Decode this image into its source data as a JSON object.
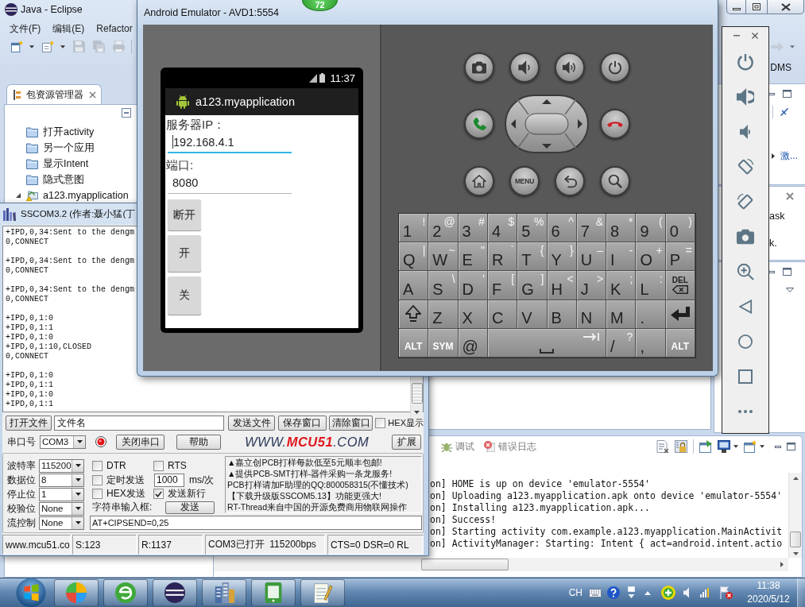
{
  "eclipse": {
    "title": "Java - Eclipse",
    "menu": [
      "文件(F)",
      "编辑(E)",
      "Refactor"
    ],
    "perspective": "DMS",
    "explorer": {
      "tab": "包资源管理器",
      "items": [
        {
          "kind": "folder",
          "label": "打开activity"
        },
        {
          "kind": "folder",
          "label": "另一个应用"
        },
        {
          "kind": "folder",
          "label": "显示Intent"
        },
        {
          "kind": "folder",
          "label": "隐式意图"
        },
        {
          "kind": "project",
          "label": "a123.myapplication",
          "expanded": true
        }
      ]
    },
    "side_link": "激...",
    "side_texts": [
      "ask",
      "k."
    ],
    "console": {
      "tabs": [
        {
          "kind": "debug",
          "label": "调试"
        },
        {
          "kind": "error-log",
          "label": "错误日志"
        }
      ],
      "lines": [
        "on] HOME is up on device 'emulator-5554'",
        "on] Uploading a123.myapplication.apk onto device 'emulator-5554'",
        "on] Installing a123.myapplication.apk...",
        "on] Success!",
        "on] Starting activity com.example.a123.myapplication.MainActivit",
        "on] ActivityManager: Starting: Intent { act=android.intent.actio"
      ]
    }
  },
  "badge": "72",
  "emulator": {
    "title": "Android Emulator - AVD1:5554",
    "phone": {
      "time": "11:37",
      "app_title": "a123.myapplication",
      "fields": [
        {
          "label": "服务器IP：",
          "value": "192.168.4.1",
          "focused": true
        },
        {
          "label": "端口:",
          "value": "8080",
          "focused": false
        }
      ],
      "buttons": [
        "断开",
        "开",
        "关"
      ]
    },
    "menu_key": "MENU",
    "keyboard": [
      [
        {
          "kind": "char",
          "main": "1",
          "alt": "!"
        },
        {
          "kind": "char",
          "main": "2",
          "alt": "@"
        },
        {
          "kind": "char",
          "main": "3",
          "alt": "#"
        },
        {
          "kind": "char",
          "main": "4",
          "alt": "$"
        },
        {
          "kind": "char",
          "main": "5",
          "alt": "%"
        },
        {
          "kind": "char",
          "main": "6",
          "alt": "^"
        },
        {
          "kind": "char",
          "main": "7",
          "alt": "&"
        },
        {
          "kind": "char",
          "main": "8",
          "alt": "*"
        },
        {
          "kind": "char",
          "main": "9",
          "alt": "("
        },
        {
          "kind": "char",
          "main": "0",
          "alt": ")"
        }
      ],
      [
        {
          "kind": "char",
          "main": "Q",
          "alt": "|"
        },
        {
          "kind": "char",
          "main": "W",
          "alt": "~"
        },
        {
          "kind": "char",
          "main": "E",
          "alt": "\""
        },
        {
          "kind": "char",
          "main": "R",
          "alt": "`"
        },
        {
          "kind": "char",
          "main": "T",
          "alt": "{"
        },
        {
          "kind": "char",
          "main": "Y",
          "alt": "}"
        },
        {
          "kind": "char",
          "main": "U",
          "alt": "–"
        },
        {
          "kind": "char",
          "main": "I",
          "alt": "-"
        },
        {
          "kind": "char",
          "main": "O",
          "alt": "+"
        },
        {
          "kind": "char",
          "main": "P",
          "alt": "="
        }
      ],
      [
        {
          "kind": "char",
          "main": "A"
        },
        {
          "kind": "char",
          "main": "S",
          "alt": "\\"
        },
        {
          "kind": "char",
          "main": "D",
          "alt": "'"
        },
        {
          "kind": "char",
          "main": "F",
          "alt": "["
        },
        {
          "kind": "char",
          "main": "G",
          "alt": "]"
        },
        {
          "kind": "char",
          "main": "H",
          "alt": "<"
        },
        {
          "kind": "char",
          "main": "J",
          "alt": ">"
        },
        {
          "kind": "char",
          "main": "K",
          "alt": ";"
        },
        {
          "kind": "char",
          "main": "L",
          "alt": ":"
        },
        {
          "kind": "del",
          "main": "DEL"
        }
      ],
      [
        {
          "kind": "shift"
        },
        {
          "kind": "char",
          "main": "Z"
        },
        {
          "kind": "char",
          "main": "X"
        },
        {
          "kind": "char",
          "main": "C"
        },
        {
          "kind": "char",
          "main": "V"
        },
        {
          "kind": "char",
          "main": "B"
        },
        {
          "kind": "char",
          "main": "N"
        },
        {
          "kind": "char",
          "main": "M"
        },
        {
          "kind": "char",
          "main": "."
        },
        {
          "kind": "enter"
        }
      ],
      [
        {
          "kind": "mod",
          "main": "ALT"
        },
        {
          "kind": "mod",
          "main": "SYM"
        },
        {
          "kind": "char",
          "main": "@"
        },
        {
          "kind": "space"
        },
        {
          "kind": "char",
          "main": "/",
          "alt": "?"
        },
        {
          "kind": "char",
          "main": ","
        },
        {
          "kind": "mod",
          "main": "ALT"
        }
      ]
    ]
  },
  "sscom": {
    "title": "SSCOM3.2 (作者:聂小猛(丁",
    "log": [
      [
        "+IPD,0,34:Sent to the dengm",
        "0,CONNECT"
      ],
      [
        "+IPD,0,34:Sent to the dengm",
        "0,CONNECT"
      ],
      [
        "+IPD,0,34:Sent to the dengm",
        "0,CONNECT"
      ],
      [
        "+IPD,0,1:0",
        "+IPD,0,1:1",
        "+IPD,0,1:0",
        "+IPD,0,1:10,CLOSED",
        "0,CONNECT"
      ],
      [
        "+IPD,0,1:0",
        "+IPD,0,1:1",
        "+IPD,0,1:0",
        "+IPD,0,1:1"
      ]
    ],
    "open_file": "打开文件",
    "file_name": "文件名",
    "file_buttons": [
      "发送文件",
      "保存窗口",
      "清除窗口"
    ],
    "hex_display": {
      "label": "HEX显示",
      "checked": false
    },
    "port_label": "串口号",
    "port": "COM3",
    "port_open": true,
    "close_port": "关闭串口",
    "help": "帮助",
    "logo": "WWW.**MCU51**.COM",
    "expand": "扩展",
    "settings": [
      {
        "label": "波特率",
        "value": "115200"
      },
      {
        "label": "数据位",
        "value": "8"
      },
      {
        "label": "停止位",
        "value": "1"
      },
      {
        "label": "校验位",
        "value": "None"
      },
      {
        "label": "流控制",
        "value": "None"
      }
    ],
    "options": [
      {
        "label": "DTR",
        "checked": false
      },
      {
        "label": "RTS",
        "checked": false
      },
      {
        "label": "定时发送",
        "checked": false
      },
      {
        "label": "HEX发送",
        "checked": false
      },
      {
        "label": "发送新行",
        "checked": true
      }
    ],
    "interval": "1000",
    "interval_unit": "ms/次",
    "input_label": "字符串输入框:",
    "send": "发送",
    "ads": [
      "▲嘉立创PCB打样每款低至5元顺丰包邮!",
      "▲提供PCB-SMT打样-器件采购一条龙服务!",
      "PCB打样请加F助理的QQ:800058315(不懂技术)",
      "【下载升级版SSCOM5.13】功能更强大!",
      "RT-Thread来自中国的开源免费商用物联网操作"
    ],
    "input": "AT+CIPSEND=0,25",
    "status": [
      "www.mcu51.co",
      "S:123",
      "R:1137",
      "COM3已打开  115200bps",
      "CTS=0 DSR=0 RL"
    ]
  },
  "taskbar": {
    "language": "CH",
    "time": "11:38",
    "date": "2020/5/12"
  }
}
